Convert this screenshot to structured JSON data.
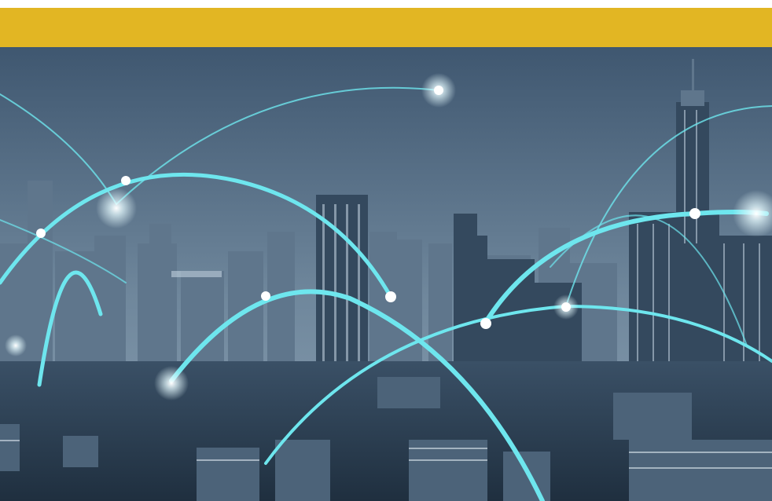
{
  "banner": {
    "color": "#E2B623"
  },
  "scene": {
    "subject": "night-city-skyline-network",
    "palette": {
      "sky_top": "#3F5770",
      "sky_bottom": "#7E95A9",
      "buildings": "#2A3D50",
      "buildings_light": "#4A6177",
      "network_line": "#6EE6EE",
      "glow": "#E6FBFF"
    }
  }
}
